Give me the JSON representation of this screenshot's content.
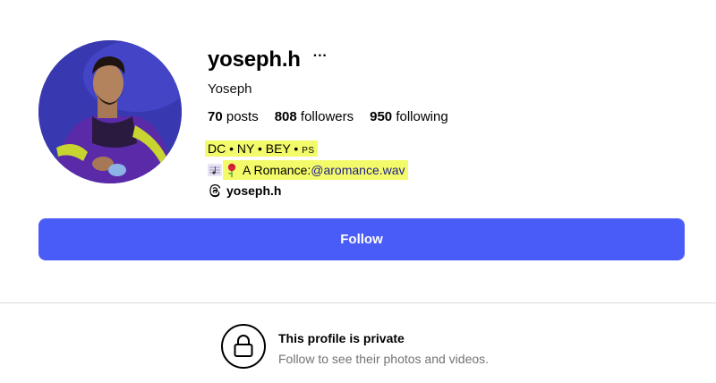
{
  "profile": {
    "username": "yoseph.h",
    "more_icon": "more-horizontal-icon",
    "full_name": "Yoseph",
    "stats": {
      "posts_count": "70",
      "posts_label": "posts",
      "followers_count": "808",
      "followers_label": "followers",
      "following_count": "950",
      "following_label": "following"
    },
    "bio": {
      "line1_main": "DC • NY • BEY • ",
      "line1_suffix": "PS",
      "line2_icons": [
        "musical-score-emoji",
        "rose-emoji"
      ],
      "line2_text": "A Romance: ",
      "line2_link": "@aromance.wav",
      "highlight_color": "#f4fb6a"
    },
    "threads": {
      "icon": "threads-icon",
      "handle": "yoseph.h"
    }
  },
  "follow_button": {
    "label": "Follow",
    "color": "#4a5cf7"
  },
  "private_notice": {
    "icon": "lock-icon",
    "title": "This profile is private",
    "subtitle": "Follow to see their photos and videos."
  }
}
